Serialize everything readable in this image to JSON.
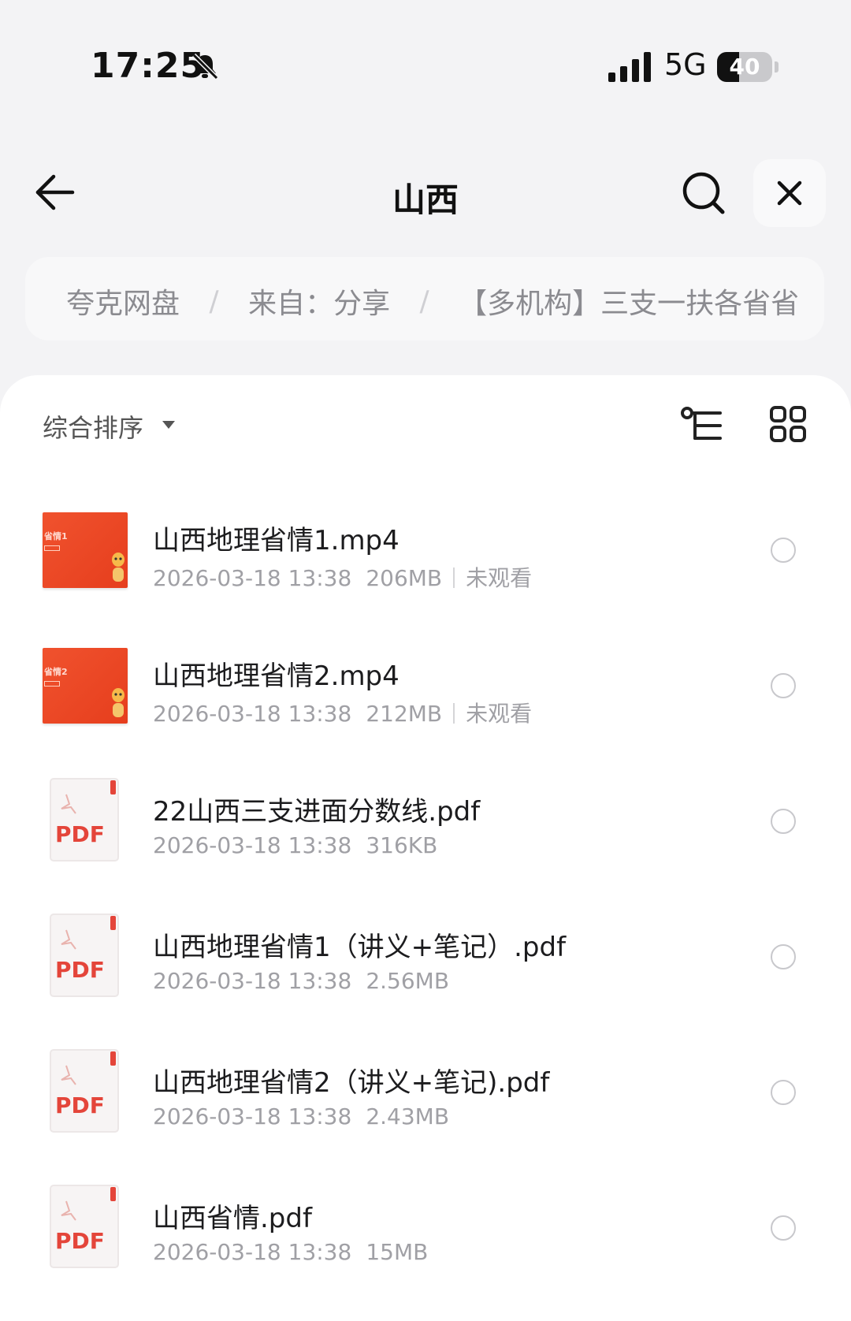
{
  "status_bar": {
    "time": "17:25",
    "network": "5G",
    "battery_level": "40",
    "battery_fraction": 0.4
  },
  "header": {
    "title": "山西"
  },
  "breadcrumb": {
    "items": [
      "夸克网盘",
      "来自：分享",
      "【多机构】三支一扶各省省"
    ]
  },
  "toolbar": {
    "sort_label": "综合排序"
  },
  "files": [
    {
      "name": "山西地理省情1.mp4",
      "date": "2026-03-18 13:38",
      "size": "206MB",
      "status": "未观看",
      "type": "video",
      "thumb_caption": "省情1"
    },
    {
      "name": "山西地理省情2.mp4",
      "date": "2026-03-18 13:38",
      "size": "212MB",
      "status": "未观看",
      "type": "video",
      "thumb_caption": "省情2"
    },
    {
      "name": "22山西三支进面分数线.pdf",
      "date": "2026-03-18 13:38",
      "size": "316KB",
      "type": "pdf",
      "thumb_label": "PDF"
    },
    {
      "name": "山西地理省情1（讲义+笔记）.pdf",
      "date": "2026-03-18 13:38",
      "size": "2.56MB",
      "type": "pdf",
      "thumb_label": "PDF"
    },
    {
      "name": "山西地理省情2（讲义+笔记).pdf",
      "date": "2026-03-18 13:38",
      "size": "2.43MB",
      "type": "pdf",
      "thumb_label": "PDF"
    },
    {
      "name": "山西省情.pdf",
      "date": "2026-03-18 13:38",
      "size": "15MB",
      "type": "pdf",
      "thumb_label": "PDF"
    }
  ],
  "colors": {
    "accent_red": "#ef4a2a",
    "pdf_red": "#e4453a",
    "text_primary": "#1c1c1e",
    "text_secondary": "#a0a0a5"
  }
}
